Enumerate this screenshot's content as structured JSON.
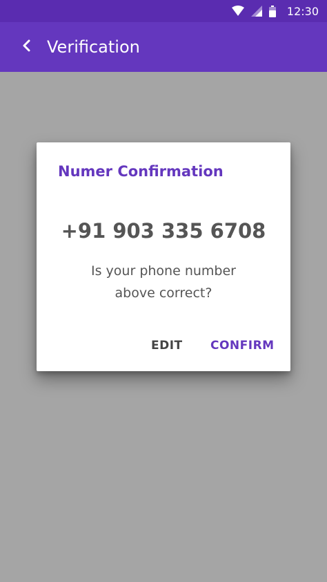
{
  "status_bar": {
    "time": "12:30",
    "icons": [
      "wifi-icon",
      "signal-icon",
      "battery-icon"
    ]
  },
  "app_bar": {
    "title": "Verification",
    "back_icon": "chevron-left-icon"
  },
  "dialog": {
    "title": "Numer Confirmation",
    "phone_number": "+91 903 335 6708",
    "message_line1": "Is your phone number",
    "message_line2": "above correct?",
    "edit_label": "EDIT",
    "confirm_label": "CONFIRM"
  },
  "colors": {
    "status_bar": "#5a2cb0",
    "primary": "#6437be",
    "scrim_background": "#a5a5a5",
    "dialog_background": "#ffffff",
    "body_text": "#555555"
  }
}
